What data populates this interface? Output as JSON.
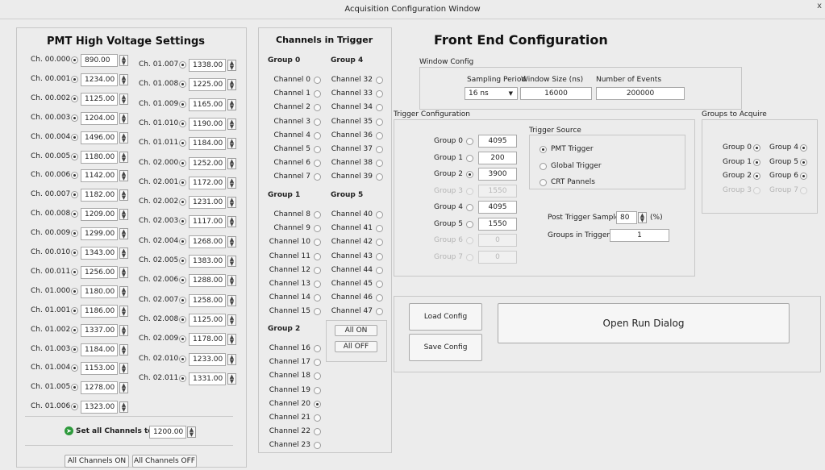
{
  "window": {
    "title": "Acquisition Configuration Window",
    "close_glyph": "x"
  },
  "pmt": {
    "title": "PMT High Voltage Settings",
    "left_col": [
      {
        "ch": "Ch. 00.000",
        "val": "890.00"
      },
      {
        "ch": "Ch. 00.001",
        "val": "1234.00"
      },
      {
        "ch": "Ch. 00.002",
        "val": "1125.00"
      },
      {
        "ch": "Ch. 00.003",
        "val": "1204.00"
      },
      {
        "ch": "Ch. 00.004",
        "val": "1496.00"
      },
      {
        "ch": "Ch. 00.005",
        "val": "1180.00"
      },
      {
        "ch": "Ch. 00.006",
        "val": "1142.00"
      },
      {
        "ch": "Ch. 00.007",
        "val": "1182.00"
      },
      {
        "ch": "Ch. 00.008",
        "val": "1209.00"
      },
      {
        "ch": "Ch. 00.009",
        "val": "1299.00"
      },
      {
        "ch": "Ch. 00.010",
        "val": "1343.00"
      },
      {
        "ch": "Ch. 00.011",
        "val": "1256.00"
      },
      {
        "ch": "Ch. 01.000",
        "val": "1180.00"
      },
      {
        "ch": "Ch. 01.001",
        "val": "1186.00"
      },
      {
        "ch": "Ch. 01.002",
        "val": "1337.00"
      },
      {
        "ch": "Ch. 01.003",
        "val": "1184.00"
      },
      {
        "ch": "Ch. 01.004",
        "val": "1153.00"
      },
      {
        "ch": "Ch. 01.005",
        "val": "1278.00"
      },
      {
        "ch": "Ch. 01.006",
        "val": "1323.00"
      }
    ],
    "right_col": [
      {
        "ch": "Ch. 01.007",
        "val": "1338.00"
      },
      {
        "ch": "Ch. 01.008",
        "val": "1225.00"
      },
      {
        "ch": "Ch. 01.009",
        "val": "1165.00"
      },
      {
        "ch": "Ch. 01.010",
        "val": "1190.00"
      },
      {
        "ch": "Ch. 01.011",
        "val": "1184.00"
      },
      {
        "ch": "Ch. 02.000",
        "val": "1252.00"
      },
      {
        "ch": "Ch. 02.001",
        "val": "1172.00"
      },
      {
        "ch": "Ch. 02.002",
        "val": "1231.00"
      },
      {
        "ch": "Ch. 02.003",
        "val": "1117.00"
      },
      {
        "ch": "Ch. 02.004",
        "val": "1268.00"
      },
      {
        "ch": "Ch. 02.005",
        "val": "1383.00"
      },
      {
        "ch": "Ch. 02.006",
        "val": "1288.00"
      },
      {
        "ch": "Ch. 02.007",
        "val": "1258.00"
      },
      {
        "ch": "Ch. 02.008",
        "val": "1125.00"
      },
      {
        "ch": "Ch. 02.009",
        "val": "1178.00"
      },
      {
        "ch": "Ch. 02.010",
        "val": "1233.00"
      },
      {
        "ch": "Ch. 02.011",
        "val": "1331.00"
      }
    ],
    "set_all_label": "Set all Channels to:",
    "set_all_value": "1200.00",
    "all_on_label": "All Channels ON",
    "all_off_label": "All Channels OFF"
  },
  "trigger_channels": {
    "title": "Channels in Trigger",
    "groups": [
      {
        "name": "Group 0",
        "channels": [
          "Channel 0",
          "Channel 1",
          "Channel 2",
          "Channel 3",
          "Channel 4",
          "Channel 5",
          "Channel 6",
          "Channel 7"
        ],
        "checked": []
      },
      {
        "name": "Group 4",
        "channels": [
          "Channel 32",
          "Channel 33",
          "Channel 34",
          "Channel 35",
          "Channel 36",
          "Channel 37",
          "Channel 38",
          "Channel 39"
        ],
        "checked": []
      },
      {
        "name": "Group 1",
        "channels": [
          "Channel 8",
          "Channel 9",
          "Channel 10",
          "Channel 11",
          "Channel 12",
          "Channel 13",
          "Channel 14",
          "Channel 15"
        ],
        "checked": []
      },
      {
        "name": "Group 5",
        "channels": [
          "Channel 40",
          "Channel 41",
          "Channel 42",
          "Channel 43",
          "Channel 44",
          "Channel 45",
          "Channel 46",
          "Channel 47"
        ],
        "checked": []
      },
      {
        "name": "Group 2",
        "channels": [
          "Channel 16",
          "Channel 17",
          "Channel 18",
          "Channel 19",
          "Channel 20",
          "Channel 21",
          "Channel 22",
          "Channel 23"
        ],
        "checked": [
          "Channel 20"
        ]
      }
    ],
    "all_on_label": "All ON",
    "all_off_label": "All OFF"
  },
  "front_end": {
    "title": "Front End Configuration",
    "window_config": {
      "title": "Window Config",
      "sampling_period_label": "Sampling Period",
      "sampling_period_value": "16 ns",
      "window_size_label": "Window Size (ns)",
      "window_size_value": "16000",
      "num_events_label": "Number of Events",
      "num_events_value": "200000"
    },
    "trigger_config": {
      "title": "Trigger Configuration",
      "groups": [
        {
          "name": "Group 0",
          "value": "4095",
          "checked": false,
          "enabled": true
        },
        {
          "name": "Group 1",
          "value": "200",
          "checked": false,
          "enabled": true
        },
        {
          "name": "Group 2",
          "value": "3900",
          "checked": true,
          "enabled": true
        },
        {
          "name": "Group 3",
          "value": "1550",
          "checked": false,
          "enabled": false
        },
        {
          "name": "Group 4",
          "value": "4095",
          "checked": false,
          "enabled": true
        },
        {
          "name": "Group 5",
          "value": "1550",
          "checked": false,
          "enabled": true
        },
        {
          "name": "Group 6",
          "value": "0",
          "checked": false,
          "enabled": false
        },
        {
          "name": "Group 7",
          "value": "0",
          "checked": false,
          "enabled": false
        }
      ],
      "trigger_source_title": "Trigger Source",
      "trigger_sources": [
        {
          "label": "PMT Trigger",
          "checked": true
        },
        {
          "label": "Global Trigger",
          "checked": false
        },
        {
          "label": "CRT Pannels",
          "checked": false
        }
      ],
      "post_trigger_label": "Post Trigger Samples",
      "post_trigger_value": "80",
      "post_trigger_unit": "(%)",
      "groups_in_trigger_label": "Groups in Trigger",
      "groups_in_trigger_value": "1"
    },
    "groups_to_acquire": {
      "title": "Groups to Acquire",
      "items": [
        {
          "label": "Group 0",
          "checked": true,
          "enabled": true
        },
        {
          "label": "Group 4",
          "checked": true,
          "enabled": true
        },
        {
          "label": "Group 1",
          "checked": true,
          "enabled": true
        },
        {
          "label": "Group 5",
          "checked": true,
          "enabled": true
        },
        {
          "label": "Group 2",
          "checked": true,
          "enabled": true
        },
        {
          "label": "Group 6",
          "checked": true,
          "enabled": true
        },
        {
          "label": "Group 3",
          "checked": false,
          "enabled": false
        },
        {
          "label": "Group 7",
          "checked": false,
          "enabled": false
        }
      ]
    },
    "load_config_label": "Load Config",
    "save_config_label": "Save Config",
    "open_run_label": "Open Run Dialog"
  }
}
